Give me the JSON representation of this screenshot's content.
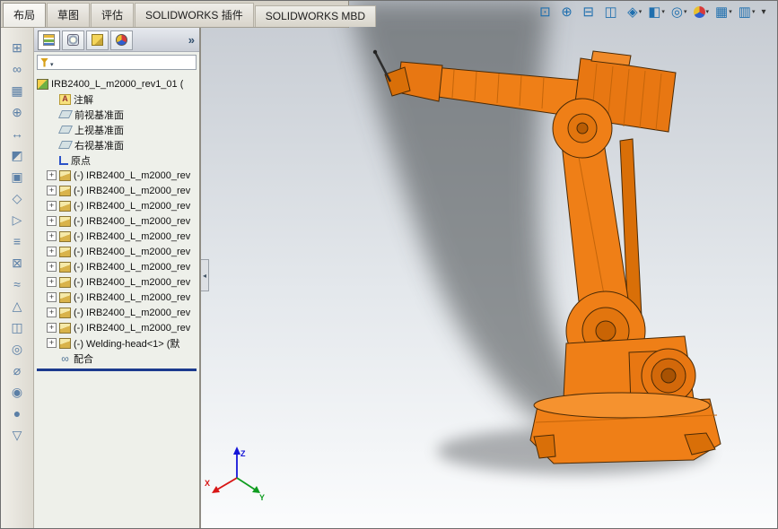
{
  "menu_tabs": {
    "items": [
      {
        "label": "布局",
        "state": "active"
      },
      {
        "label": "草图",
        "state": ""
      },
      {
        "label": "评估",
        "state": ""
      },
      {
        "label": "SOLIDWORKS 插件",
        "state": ""
      },
      {
        "label": "SOLIDWORKS MBD",
        "state": ""
      }
    ]
  },
  "headsup": {
    "icons": [
      {
        "name": "zoom-to-fit",
        "glyph": "⊡",
        "caret": false,
        "cls": ""
      },
      {
        "name": "zoom-to-area",
        "glyph": "⊕",
        "caret": false,
        "cls": ""
      },
      {
        "name": "section-view",
        "glyph": "⊟",
        "caret": false,
        "cls": ""
      },
      {
        "name": "3d-drawing-view",
        "glyph": "◫",
        "caret": false,
        "cls": ""
      },
      {
        "name": "view-orientation",
        "glyph": "◈",
        "caret": true,
        "cls": ""
      },
      {
        "name": "display-style",
        "glyph": "◧",
        "caret": true,
        "cls": ""
      },
      {
        "name": "hide-show-items",
        "glyph": "◎",
        "caret": true,
        "cls": ""
      },
      {
        "name": "edit-appearance",
        "glyph": "●",
        "caret": true,
        "cls": "ball"
      },
      {
        "name": "apply-scene",
        "glyph": "▦",
        "caret": true,
        "cls": ""
      },
      {
        "name": "view-settings",
        "glyph": "▥",
        "caret": true,
        "cls": ""
      },
      {
        "name": "toolbar-options",
        "glyph": "▾",
        "caret": false,
        "cls": "opt"
      }
    ]
  },
  "left_toolbar": {
    "icons": [
      {
        "name": "insert-component",
        "glyph": "⊞"
      },
      {
        "name": "mate",
        "glyph": "∞"
      },
      {
        "name": "linear-component-pattern",
        "glyph": "▦"
      },
      {
        "name": "smart-fasteners",
        "glyph": "⊕"
      },
      {
        "name": "move-component",
        "glyph": "↔"
      },
      {
        "name": "show-hidden-components",
        "glyph": "◩"
      },
      {
        "name": "assembly-features",
        "glyph": "▣"
      },
      {
        "name": "reference-geometry",
        "glyph": "◇"
      },
      {
        "name": "new-motion-study",
        "glyph": "▷"
      },
      {
        "name": "bill-of-materials",
        "glyph": "≡"
      },
      {
        "name": "exploded-view",
        "glyph": "⊠"
      },
      {
        "name": "explode-line-sketch",
        "glyph": "≈"
      },
      {
        "name": "interference-detection",
        "glyph": "△"
      },
      {
        "name": "clearance-verification",
        "glyph": "◫"
      },
      {
        "name": "hole-alignment",
        "glyph": "◎"
      },
      {
        "name": "measure",
        "glyph": "⌀"
      },
      {
        "name": "mass-properties",
        "glyph": "◉"
      },
      {
        "name": "appearance",
        "glyph": "●"
      },
      {
        "name": "simulation",
        "glyph": "▽"
      }
    ]
  },
  "panel": {
    "tabs": [
      {
        "name": "feature-manager-tab",
        "cls": "tab-fm-i",
        "state": "active"
      },
      {
        "name": "property-manager-tab",
        "cls": "tab-pm-i",
        "state": ""
      },
      {
        "name": "configuration-manager-tab",
        "cls": "tab-cm-i",
        "state": ""
      },
      {
        "name": "display-manager-tab",
        "cls": "tab-dm-i",
        "state": ""
      }
    ],
    "more_label": "»",
    "tree": {
      "items": [
        {
          "label": "IRB2400_L_m2000_rev1_01 (",
          "icon": "ic-assembly",
          "exp": false,
          "cls": "root"
        },
        {
          "label": "注解",
          "icon": "ic-annotation",
          "exp": false,
          "cls": ""
        },
        {
          "label": "前视基准面",
          "icon": "ic-plane",
          "exp": false,
          "cls": ""
        },
        {
          "label": "上视基准面",
          "icon": "ic-plane",
          "exp": false,
          "cls": ""
        },
        {
          "label": "右视基准面",
          "icon": "ic-plane",
          "exp": false,
          "cls": ""
        },
        {
          "label": "原点",
          "icon": "ic-origin",
          "exp": false,
          "cls": ""
        },
        {
          "label": "(-) IRB2400_L_m2000_rev",
          "icon": "ic-part",
          "exp": true,
          "cls": ""
        },
        {
          "label": "(-) IRB2400_L_m2000_rev",
          "icon": "ic-part",
          "exp": true,
          "cls": ""
        },
        {
          "label": "(-) IRB2400_L_m2000_rev",
          "icon": "ic-part",
          "exp": true,
          "cls": ""
        },
        {
          "label": "(-) IRB2400_L_m2000_rev",
          "icon": "ic-part",
          "exp": true,
          "cls": ""
        },
        {
          "label": "(-) IRB2400_L_m2000_rev",
          "icon": "ic-part",
          "exp": true,
          "cls": ""
        },
        {
          "label": "(-) IRB2400_L_m2000_rev",
          "icon": "ic-part",
          "exp": true,
          "cls": ""
        },
        {
          "label": "(-) IRB2400_L_m2000_rev",
          "icon": "ic-part",
          "exp": true,
          "cls": ""
        },
        {
          "label": "(-) IRB2400_L_m2000_rev",
          "icon": "ic-part",
          "exp": true,
          "cls": ""
        },
        {
          "label": "(-) IRB2400_L_m2000_rev",
          "icon": "ic-part",
          "exp": true,
          "cls": ""
        },
        {
          "label": "(-) IRB2400_L_m2000_rev",
          "icon": "ic-part",
          "exp": true,
          "cls": ""
        },
        {
          "label": "(-) IRB2400_L_m2000_rev",
          "icon": "ic-part",
          "exp": true,
          "cls": ""
        },
        {
          "label": "(-) Welding-head<1> (默",
          "icon": "ic-part",
          "exp": true,
          "cls": ""
        },
        {
          "label": "配合",
          "icon": "ic-mates",
          "exp": false,
          "cls": ""
        }
      ]
    }
  },
  "viewport": {
    "triad": {
      "x": "X",
      "y": "Y",
      "z": "Z"
    },
    "colors": {
      "robot_orange": "#ef7f17",
      "shadow_gray": "#43464a",
      "background_top": "#c6cbd2",
      "background_bottom": "#fbfcfd",
      "triad_x": "#d81515",
      "triad_y": "#0f9c20",
      "triad_z": "#1515d8"
    }
  }
}
